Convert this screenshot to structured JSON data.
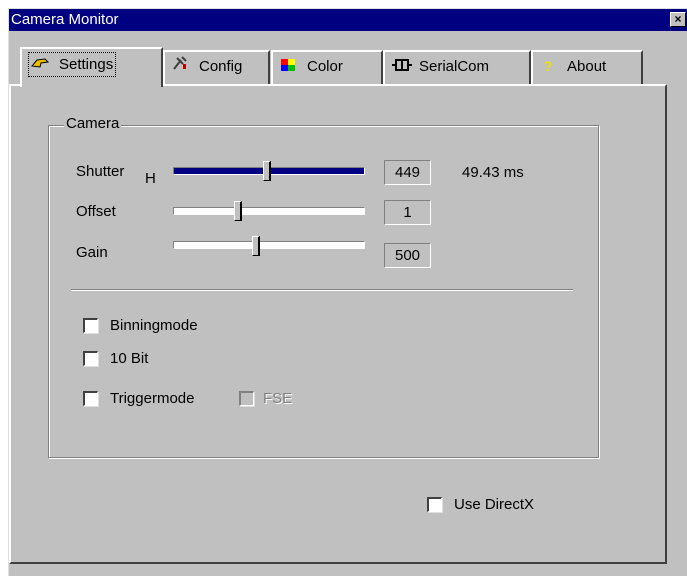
{
  "window": {
    "title": "Camera Monitor",
    "close_glyph": "×"
  },
  "tabs": [
    {
      "label": "Settings",
      "icon": "hand-pointer-icon",
      "active": true
    },
    {
      "label": "Config",
      "icon": "tools-icon",
      "active": false
    },
    {
      "label": "Color",
      "icon": "color-squares-icon",
      "active": false
    },
    {
      "label": "SerialCom",
      "icon": "serial-port-icon",
      "active": false
    },
    {
      "label": "About",
      "icon": "question-mark-icon",
      "active": false
    }
  ],
  "camera_group": {
    "title": "Camera",
    "sliders": [
      {
        "label": "Shutter",
        "suffix": "H",
        "value": "449",
        "extra": "49.43 ms",
        "level": 0.49,
        "selected": true
      },
      {
        "label": "Offset",
        "value": "1",
        "level": 0.34,
        "selected": false
      },
      {
        "label": "Gain",
        "value": "500",
        "level": 0.43,
        "selected": false
      }
    ],
    "checkboxes": [
      {
        "label": "Binningmode",
        "checked": false,
        "enabled": true
      },
      {
        "label": "10 Bit",
        "checked": false,
        "enabled": true
      },
      {
        "label": "Triggermode",
        "checked": false,
        "enabled": true
      },
      {
        "label": "FSE",
        "checked": false,
        "enabled": false
      }
    ]
  },
  "use_directx": {
    "label": "Use DirectX",
    "checked": false
  },
  "colors": {
    "titlebar": "#000080",
    "face": "#c0c0c0",
    "slider_selection": "#000080"
  }
}
